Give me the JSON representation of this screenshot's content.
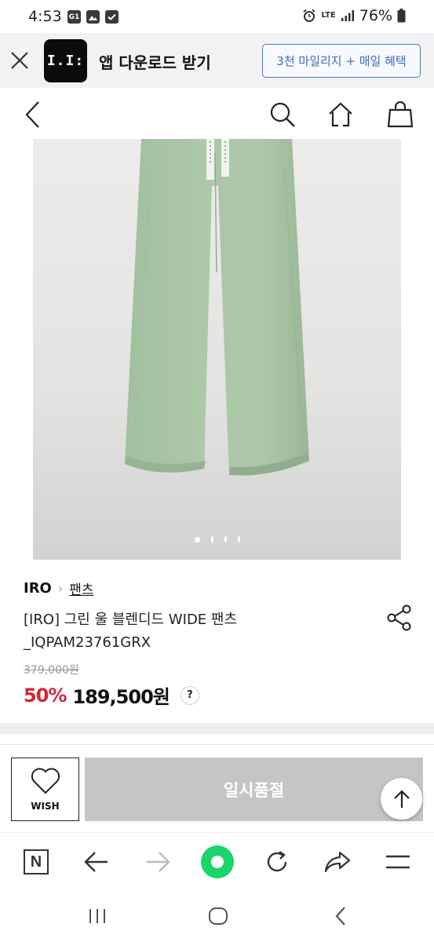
{
  "status_bar": {
    "time": "4:53",
    "left_icons": [
      "G1-icon",
      "gallery-icon",
      "check-icon"
    ],
    "network": "LTE",
    "battery": "76%"
  },
  "app_banner": {
    "logo_text": "I.I:",
    "title": "앱 다운로드 받기",
    "cta_label": "3천 마일리지 + 매일 혜택"
  },
  "product": {
    "brand": "IRO",
    "category": "팬츠",
    "name_line1": "[IRO] 그린 울 블렌디드 WIDE 팬츠",
    "name_line2": "_IQPAM23761GRX",
    "original_price": "379,000원",
    "discount": "50%",
    "sale_price": "189,500원",
    "help": "?",
    "image_count": 4,
    "current_image": 1,
    "colors": {
      "pants": "#a9c6a6",
      "discount": "#d0283a"
    }
  },
  "actions": {
    "wish_label": "WISH",
    "status_label": "일시품절"
  }
}
